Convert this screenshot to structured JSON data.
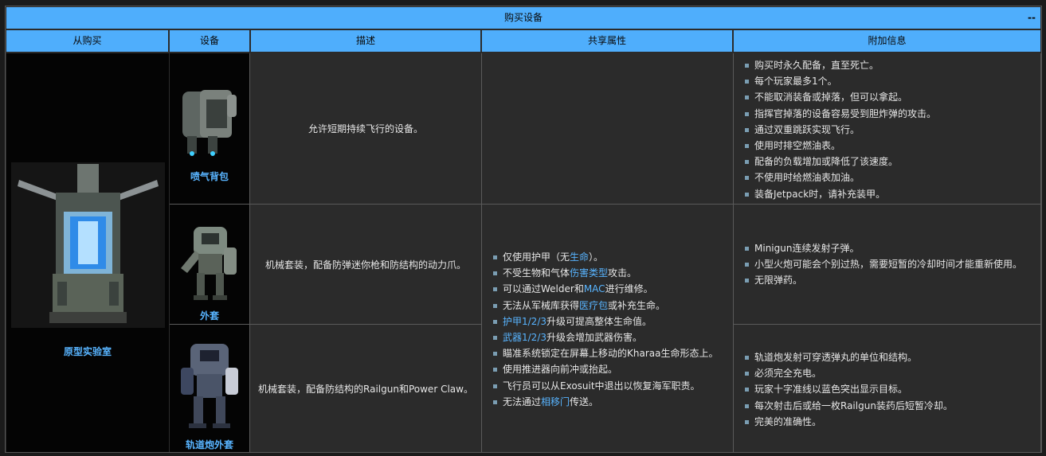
{
  "title": "购买设备",
  "collapse_label": "--",
  "headers": [
    "从购买",
    "设备",
    "描述",
    "共享属性",
    "附加信息"
  ],
  "source": {
    "name": "原型实验室",
    "image": "prototype-lab-structure"
  },
  "equipment": [
    {
      "name": "喷气背包",
      "image": "jetpack",
      "description": "允许短期持续飞行的设备。",
      "info": [
        "购买时永久配备，直至死亡。",
        "每个玩家最多1个。",
        "不能取消装备或掉落，但可以拿起。",
        "指挥官掉落的设备容易受到胆炸弹的攻击。",
        "通过双重跳跃实现飞行。",
        "使用时排空燃油表。",
        "配备的负载增加或降低了该速度。",
        "不使用时给燃油表加油。",
        "装备Jetpack时，请补充装甲。"
      ]
    },
    {
      "name": "外套",
      "image": "exosuit-minigun",
      "description": "机械套装，配备防弹迷你枪和防结构的动力爪。",
      "info": [
        "Minigun连续发射子弹。",
        "小型火炮可能会个别过热，需要短暂的冷却时间才能重新使用。",
        "无限弹药。"
      ]
    },
    {
      "name": "轨道炮外套",
      "image": "exosuit-railgun",
      "description": "机械套装，配备防结构的Railgun和Power Claw。",
      "info": [
        "轨道炮发射可穿透弹丸的单位和结构。",
        "必须完全充电。",
        "玩家十字准线以蓝色突出显示目标。",
        "每次射击后或给一枚Railgun装药后短暂冷却。",
        "完美的准确性。"
      ]
    }
  ],
  "shared": [
    [
      {
        "t": "仅使用护甲（无"
      },
      {
        "t": "生命",
        "link": true
      },
      {
        "t": "）。"
      }
    ],
    [
      {
        "t": "不受生物和气体"
      },
      {
        "t": "伤害类型",
        "link": true
      },
      {
        "t": "攻击。"
      }
    ],
    [
      {
        "t": "可以通过Welder和"
      },
      {
        "t": "MAC",
        "link": true
      },
      {
        "t": "进行维修。"
      }
    ],
    [
      {
        "t": "无法从军械库获得"
      },
      {
        "t": "医疗包",
        "link": true
      },
      {
        "t": "或补充生命。"
      }
    ],
    [
      {
        "t": "护甲1/2/3",
        "link": true
      },
      {
        "t": "升级可提高整体生命值。"
      }
    ],
    [
      {
        "t": "武器1/2/3",
        "link": true
      },
      {
        "t": "升级会增加武器伤害。"
      }
    ],
    [
      {
        "t": "瞄准系统锁定在屏幕上移动的Kharaa生命形态上。"
      }
    ],
    [
      {
        "t": "使用推进器向前冲或抬起。"
      }
    ],
    [
      {
        "t": "飞行员可以从Exosuit中退出以恢复海军职责。"
      }
    ],
    [
      {
        "t": "无法通过"
      },
      {
        "t": "相移门",
        "link": true
      },
      {
        "t": "传送。"
      }
    ]
  ],
  "colors": {
    "header_bg": "#4faefc",
    "link": "#58b4ff",
    "cell_bg": "#2b2b2b",
    "image_bg": "#040404"
  }
}
